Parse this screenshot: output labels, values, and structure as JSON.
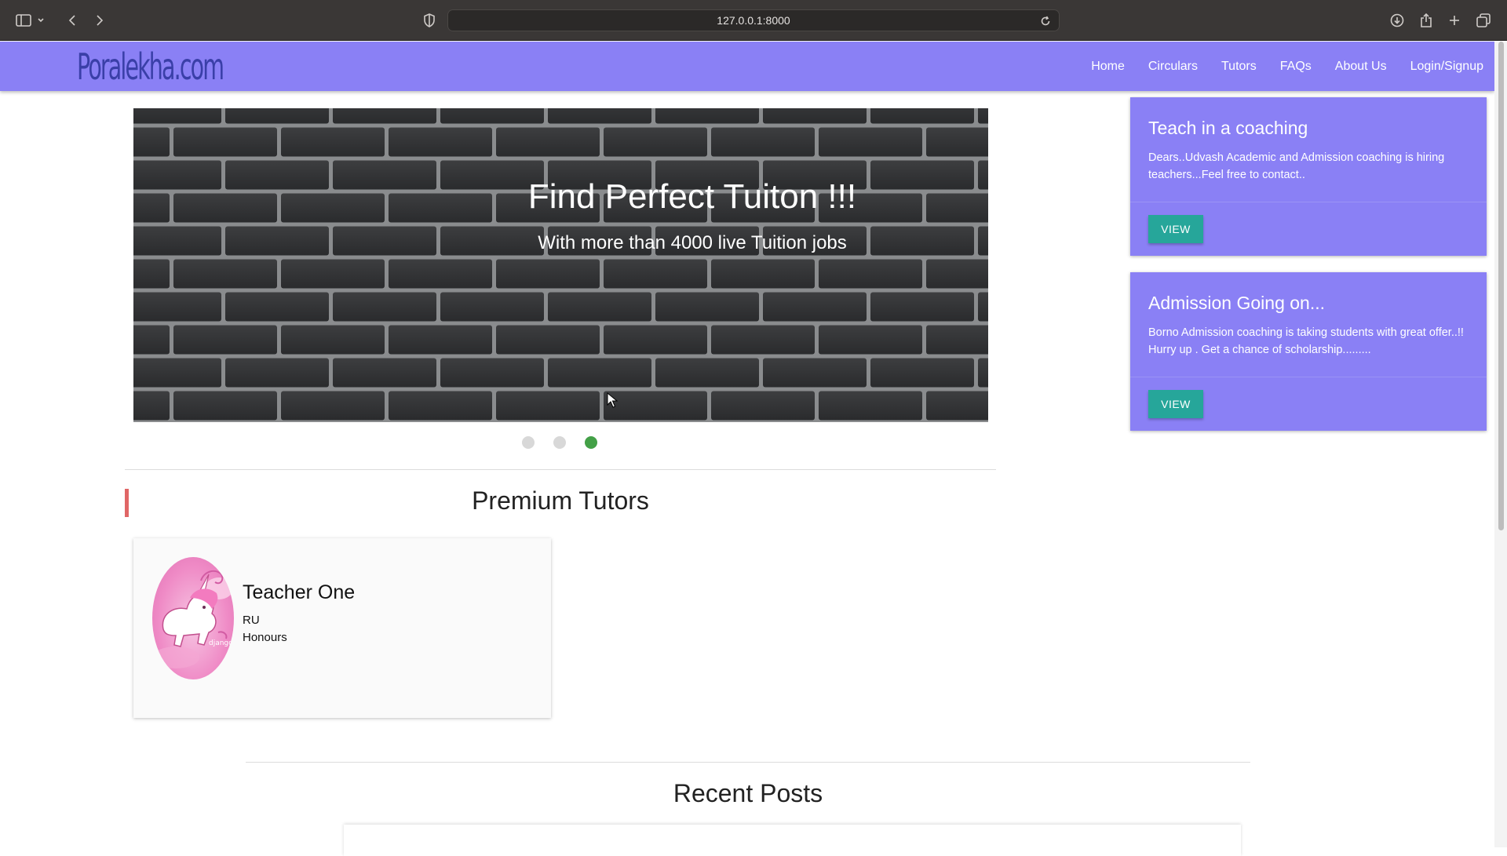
{
  "browser": {
    "url": "127.0.0.1:8000",
    "icons": [
      "sidebar-icon",
      "chevron-down-icon",
      "back-icon",
      "forward-icon",
      "shield-icon",
      "reload-icon",
      "download-icon",
      "share-icon",
      "plus-icon",
      "tabs-icon"
    ]
  },
  "nav": {
    "brand": "Poralekha.com",
    "links": [
      "Home",
      "Circulars",
      "Tutors",
      "FAQs",
      "About Us",
      "Login/Signup"
    ]
  },
  "carousel": {
    "title": "Find Perfect Tuiton !!!",
    "subtitle": "With more than 4000 live Tuition jobs",
    "slide_count": 3,
    "active_index": 2
  },
  "premium": {
    "title": "Premium Tutors",
    "tutors": [
      {
        "name": "Teacher One",
        "university": "RU",
        "degree": "Honours",
        "avatar_text": "django"
      }
    ]
  },
  "recent": {
    "title": "Recent Posts"
  },
  "side_cards": [
    {
      "title": "Teach in a coaching",
      "body": "Dears..Udvash Academic and Admission coaching is hiring teachers...Feel free to contact..",
      "button": "VIEW"
    },
    {
      "title": "Admission Going on...",
      "body": "Borno Admission coaching is taking students with great offer..!! Hurry up . Get a chance of scholarship.........",
      "button": "VIEW"
    }
  ],
  "colors": {
    "navbar": "#8a80f5",
    "brand_text": "#3a3fa8",
    "button": "#26a69a",
    "indicator_active": "#43a047",
    "accent": "#e06666"
  }
}
